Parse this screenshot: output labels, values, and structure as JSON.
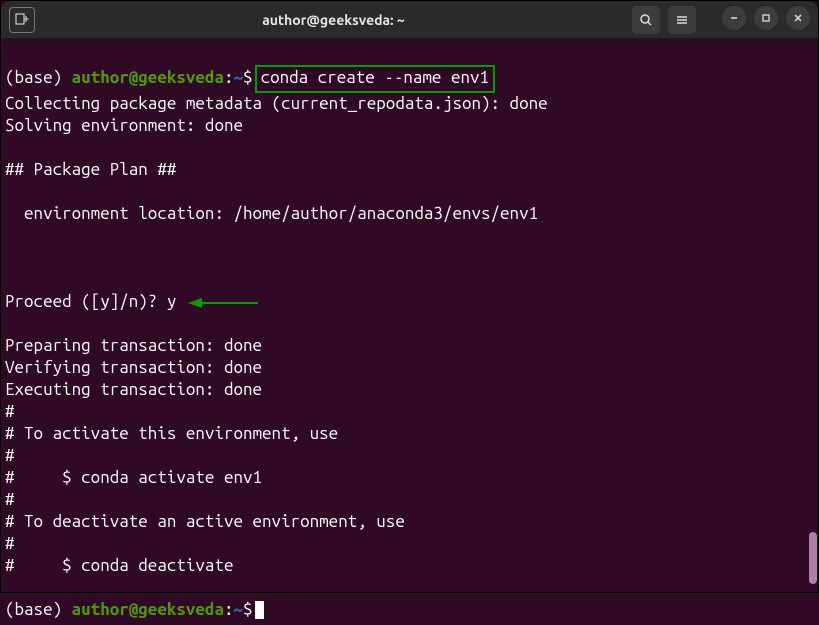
{
  "titlebar": {
    "title": "author@geeksveda: ~",
    "icons": {
      "newtab": "+",
      "search": "search-icon",
      "menu": "menu-icon",
      "minimize": "–",
      "maximize": "▢",
      "close": "✕"
    }
  },
  "prompt": {
    "base": "(base) ",
    "userhost": "author@geeksveda",
    "sep": ":",
    "path": "~",
    "dollar": "$",
    "command": "conda create --name env1"
  },
  "output": {
    "l1": "Collecting package metadata (current_repodata.json): done",
    "l2": "Solving environment: done",
    "l3": "",
    "l4": "## Package Plan ##",
    "l5": "",
    "l6": "  environment location: /home/author/anaconda3/envs/env1",
    "l7": "",
    "l8": "",
    "l9": "",
    "proceed": "Proceed ([y]/n)? y",
    "l11": "",
    "l12": "Preparing transaction: done",
    "l13": "Verifying transaction: done",
    "l14": "Executing transaction: done",
    "l15": "#",
    "l16": "# To activate this environment, use",
    "l17": "#",
    "l18": "#     $ conda activate env1",
    "l19": "#",
    "l20": "# To deactivate an active environment, use",
    "l21": "#",
    "l22": "#     $ conda deactivate",
    "l23": ""
  },
  "prompt2": {
    "base": "(base) ",
    "userhost": "author@geeksveda",
    "sep": ":",
    "path": "~",
    "dollar": "$"
  }
}
